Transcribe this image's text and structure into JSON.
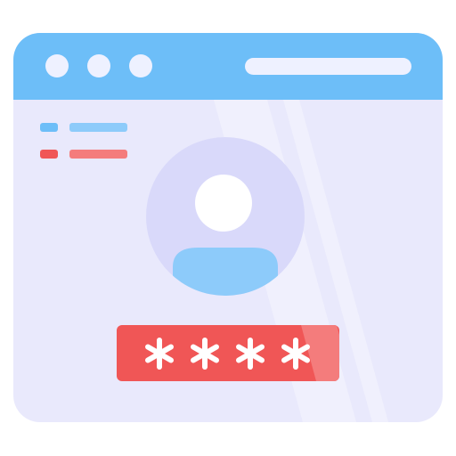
{
  "illustration": {
    "subject": "browser-window-login",
    "colors": {
      "titlebar": "#6DBEF8",
      "titlebar_dot": "#EEF1FF",
      "address_bar": "#EEF1FF",
      "window_body": "#E9E9FC",
      "avatar_circle": "#D9D9FA",
      "avatar_head": "#FFFFFF",
      "avatar_shoulders": "#8DCBFA",
      "line_blue_short": "#6DBEF8",
      "line_blue_long": "#8DCBFA",
      "line_red_short": "#F05656",
      "line_red_long": "#F47C7C",
      "password_field": "#F05656",
      "password_highlight": "#F47C7C",
      "password_glyph": "#FFFFFF"
    },
    "password": {
      "masked_character_count": 4
    },
    "icons": [
      "window-dot-icon",
      "user-avatar-icon",
      "asterisk-icon"
    ]
  }
}
